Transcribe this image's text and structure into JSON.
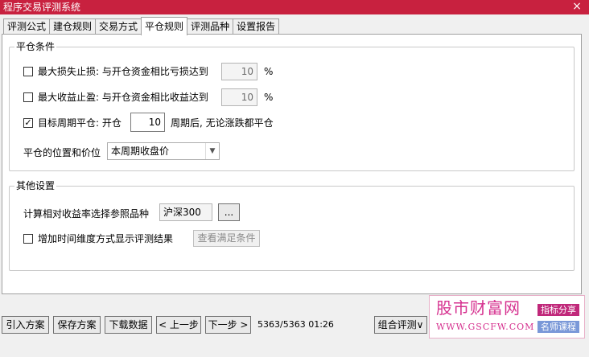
{
  "window": {
    "title": "程序交易评测系统",
    "close_glyph": "×"
  },
  "tabs": [
    {
      "label": "评测公式"
    },
    {
      "label": "建仓规则"
    },
    {
      "label": "交易方式"
    },
    {
      "label": "平仓规则"
    },
    {
      "label": "评测品种"
    },
    {
      "label": "设置报告"
    }
  ],
  "active_tab_index": 3,
  "close_conditions": {
    "title": "平仓条件",
    "max_loss": {
      "checked": false,
      "label": "最大损失止损: 与开仓资金相比亏损达到",
      "value": "10",
      "unit": "%"
    },
    "max_profit": {
      "checked": false,
      "label": "最大收益止盈: 与开仓资金相比收益达到",
      "value": "10",
      "unit": "%"
    },
    "period": {
      "checked": true,
      "check_glyph": "✓",
      "label": "目标周期平仓: 开仓",
      "value": "10",
      "suffix": "周期后, 无论涨跌都平仓"
    },
    "position": {
      "label": "平仓的位置和价位",
      "selected": "本周期收盘价",
      "arrow_glyph": "▼"
    }
  },
  "other_settings": {
    "title": "其他设置",
    "reference": {
      "label": "计算相对收益率选择参照品种",
      "value": "沪深300",
      "browse_label": "..."
    },
    "time_dimension": {
      "checked": false,
      "label": "增加时间维度方式显示评测结果",
      "button_label": "查看满足条件"
    }
  },
  "bottom_bar": {
    "buttons": [
      {
        "label": "引入方案"
      },
      {
        "label": "保存方案"
      },
      {
        "label": "下载数据"
      },
      {
        "label": "< 上一步"
      },
      {
        "label": "下一步 >"
      }
    ],
    "status": "5363/5363 01:26",
    "combo_label": "组合评测∨"
  },
  "watermark": {
    "brand": "股市财富网",
    "url": "WWW.GSCFW.COM",
    "tag1": "指标分享",
    "tag2": "名师课程"
  }
}
